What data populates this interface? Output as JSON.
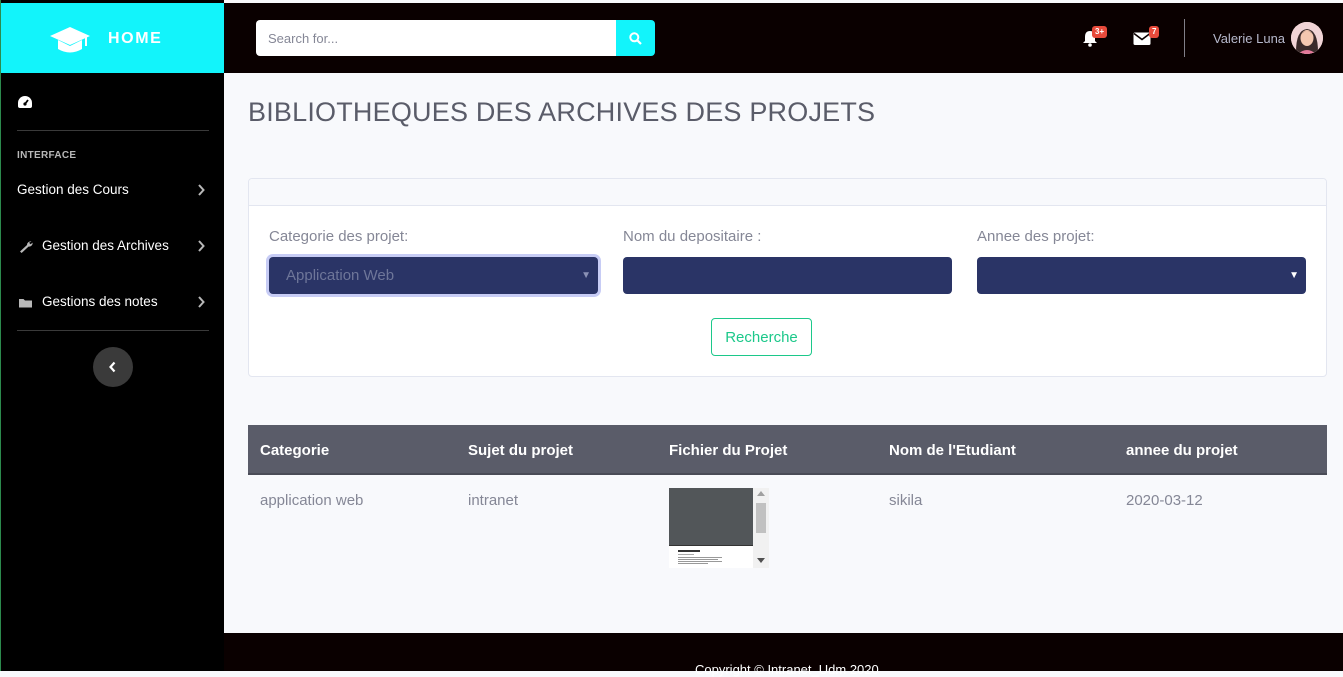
{
  "sidebar": {
    "brand": "HOME",
    "heading": "INTERFACE",
    "items": [
      {
        "label": "Gestion des Cours",
        "icon": "none"
      },
      {
        "label": "Gestion des Archives",
        "icon": "wrench-icon"
      },
      {
        "label": "Gestions des notes",
        "icon": "folder-icon"
      }
    ]
  },
  "topbar": {
    "search_placeholder": "Search for...",
    "alerts_badge": "3+",
    "messages_badge": "7",
    "user_name": "Valerie Luna"
  },
  "main": {
    "title": "BIBLIOTHEQUES DES ARCHIVES DES PROJETS",
    "form": {
      "category_label": "Categorie des projet:",
      "category_value": "Application Web",
      "depositor_label": "Nom du depositaire :",
      "depositor_value": "",
      "year_label": "Annee des projet:",
      "year_value": "",
      "submit_label": "Recherche"
    },
    "table": {
      "headers": [
        "Categorie",
        "Sujet du projet",
        "Fichier du Projet",
        "Nom de l'Etudiant",
        "annee du projet"
      ],
      "rows": [
        {
          "categorie": "application web",
          "sujet": "intranet",
          "etudiant": "sikila",
          "annee": "2020-03-12"
        }
      ]
    }
  },
  "footer": {
    "copyright": "Copyright © Intranet_Udm 2020"
  },
  "colors": {
    "brand": "#12f4fb",
    "topbar": "#0a0000",
    "sidebar": "#000000",
    "field": "#2a3466",
    "table_header": "#5a5c69",
    "success": "#1cc88a",
    "badge": "#e74a3b"
  }
}
